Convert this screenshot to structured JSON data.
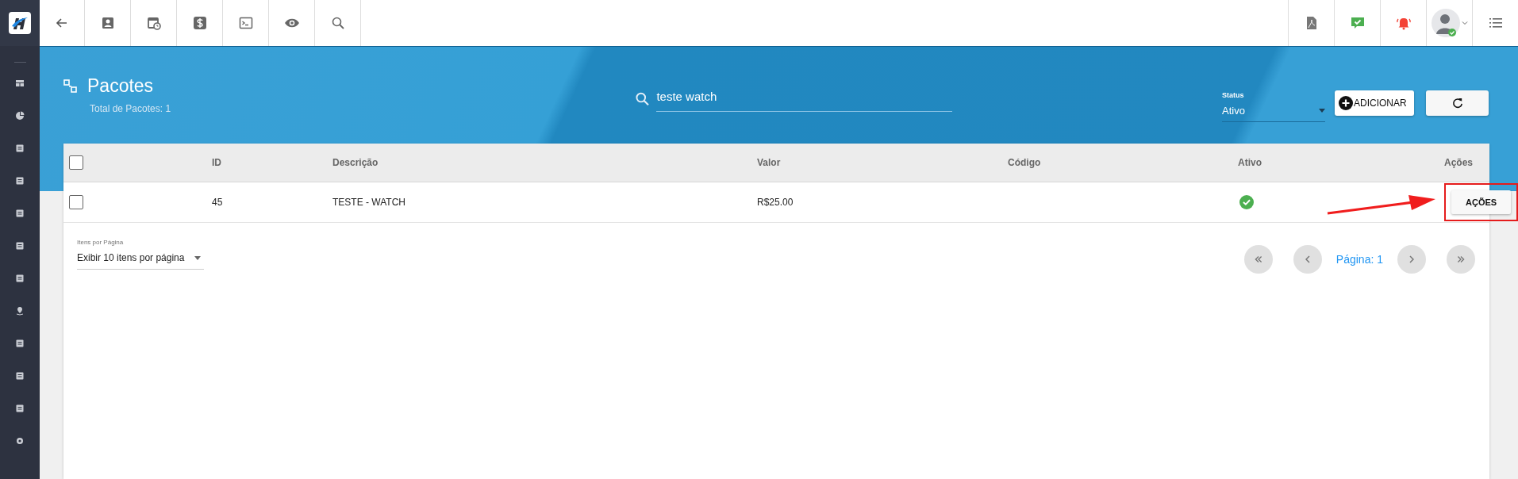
{
  "page": {
    "title": "Pacotes",
    "subtitle": "Total de Pacotes: 1"
  },
  "search": {
    "value": "teste watch"
  },
  "status_filter": {
    "label": "Status",
    "value": "Ativo"
  },
  "add_button": {
    "label": "ADICIONAR"
  },
  "table": {
    "select_all": {
      "checked": false
    },
    "columns": [
      "ID",
      "Descrição",
      "Valor",
      "Código",
      "Ativo",
      "Ações"
    ],
    "rows": [
      {
        "checked": false,
        "id": "45",
        "description": "TESTE - WATCH",
        "value": "R$25.00",
        "active": true,
        "action": "AÇÕES"
      }
    ]
  },
  "page_size": {
    "label": "Itens por Página",
    "value": "Exibir 10 itens por página"
  },
  "pagination": {
    "label": "Página: 1"
  }
}
